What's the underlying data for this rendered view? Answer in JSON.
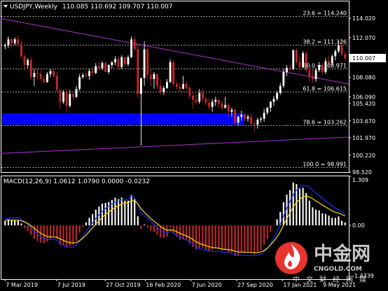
{
  "header": {
    "symbol": "USDJPY,Weekly",
    "ohlc": "110.085 110.692 109.707 110.007",
    "macd_label": "MACD(12,26,9) 1.0612 1.0790 0.0000 -0.0232"
  },
  "colors": {
    "background": "#000000",
    "grid": "#ffffff",
    "bull": "#ffffff",
    "bear": "#c8262a",
    "trendline": "#9b2fb8",
    "support_zone": "#0000ff",
    "macd_hist_up": "#ffffff",
    "macd_hist_down": "#c8262a",
    "macd_signal": "#ffd700",
    "macd_main": "#1034ff",
    "current_price_tag": "#ffffff"
  },
  "watermark": {
    "brand_cn": "中金网",
    "brand_en": "CNGOLD.COM",
    "slogan": "中文财经网媒",
    "icon": "flame-logo-icon"
  },
  "chart_data": [
    {
      "type": "candlestick",
      "title": "USDJPY,Weekly",
      "ylim": [
        98.52,
        115.72
      ],
      "y_ticks": [
        "114.020",
        "112.070",
        "110.007",
        "108.080",
        "106.090",
        "105.420",
        "103.670",
        "101.970",
        "100.220",
        "98.520"
      ],
      "current_price": "110.007",
      "x_ticks": [
        "7 Mar 2019",
        "7 Jul 2019",
        "27 Oct 2019",
        "16 Feb 2020",
        "7 Jun 2020",
        "27 Sep 2020",
        "17 Jan 2021",
        "9 May 2021"
      ],
      "fib_levels": [
        {
          "label": "23.6 = 114.240",
          "value": 114.24
        },
        {
          "label": "38.2 = 111.326",
          "value": 111.326
        },
        {
          "label": "50.0 = 108.971",
          "value": 108.971
        },
        {
          "label": "61.8 = 106.615",
          "value": 106.615
        },
        {
          "label": "78.6 = 103.262",
          "value": 103.262
        },
        {
          "label": "100.0 = 98.991",
          "value": 98.991
        }
      ],
      "support_zone": {
        "low": 103.3,
        "high": 104.45
      },
      "trendlines": [
        {
          "name": "upper",
          "from": [
            0,
            114.0
          ],
          "to": [
            129,
            107.4
          ]
        },
        {
          "name": "lower",
          "from": [
            0,
            100.4
          ],
          "to": [
            129,
            102.05
          ]
        }
      ],
      "bars": [
        [
          111.2,
          111.5,
          110.9,
          111.3
        ],
        [
          111.3,
          112.2,
          111.0,
          111.9
        ],
        [
          111.9,
          112.0,
          111.1,
          111.5
        ],
        [
          111.5,
          112.1,
          111.3,
          111.9
        ],
        [
          111.9,
          112.3,
          111.5,
          111.4
        ],
        [
          111.4,
          111.7,
          110.0,
          110.2
        ],
        [
          110.2,
          110.4,
          108.8,
          109.3
        ],
        [
          109.3,
          110.0,
          109.0,
          109.8
        ],
        [
          109.8,
          110.1,
          107.8,
          108.1
        ],
        [
          108.1,
          108.9,
          107.2,
          108.5
        ],
        [
          108.5,
          109.0,
          107.9,
          108.4
        ],
        [
          108.4,
          108.8,
          107.7,
          107.9
        ],
        [
          107.9,
          108.2,
          107.4,
          107.6
        ],
        [
          107.6,
          108.6,
          107.5,
          108.4
        ],
        [
          108.4,
          108.9,
          108.1,
          108.7
        ],
        [
          108.7,
          108.9,
          108.1,
          108.2
        ],
        [
          108.2,
          108.6,
          106.6,
          106.8
        ],
        [
          106.8,
          106.9,
          104.9,
          105.6
        ],
        [
          105.6,
          106.8,
          105.4,
          106.6
        ],
        [
          106.6,
          106.9,
          104.5,
          105.2
        ],
        [
          105.2,
          106.8,
          105.0,
          106.4
        ],
        [
          106.4,
          106.6,
          105.8,
          106.1
        ],
        [
          106.1,
          107.2,
          106.0,
          106.9
        ],
        [
          106.9,
          108.4,
          106.7,
          108.1
        ],
        [
          108.1,
          108.5,
          107.9,
          108.3
        ],
        [
          108.3,
          108.7,
          108.0,
          108.2
        ],
        [
          108.2,
          108.9,
          107.8,
          108.7
        ],
        [
          108.7,
          109.1,
          108.3,
          108.5
        ],
        [
          108.5,
          109.5,
          108.4,
          109.2
        ],
        [
          109.2,
          109.6,
          108.9,
          109.0
        ],
        [
          109.0,
          109.7,
          108.8,
          109.5
        ],
        [
          109.5,
          109.7,
          108.6,
          108.6
        ],
        [
          108.6,
          109.4,
          108.4,
          109.3
        ],
        [
          109.3,
          109.7,
          109.0,
          109.6
        ],
        [
          109.6,
          110.2,
          109.3,
          109.9
        ],
        [
          109.9,
          110.2,
          108.9,
          109.1
        ],
        [
          109.1,
          110.3,
          108.9,
          110.1
        ],
        [
          110.1,
          110.0,
          109.2,
          109.4
        ],
        [
          109.4,
          110.3,
          109.2,
          110.1
        ],
        [
          110.1,
          112.2,
          110.0,
          111.9
        ],
        [
          111.9,
          112.2,
          110.7,
          110.9
        ],
        [
          110.9,
          111.3,
          106.0,
          106.4
        ],
        [
          106.4,
          106.8,
          101.2,
          108.0
        ],
        [
          108.0,
          111.7,
          107.2,
          110.9
        ],
        [
          110.9,
          111.0,
          107.8,
          108.3
        ],
        [
          108.3,
          108.9,
          107.2,
          107.9
        ],
        [
          107.9,
          108.6,
          106.9,
          108.4
        ],
        [
          108.4,
          108.2,
          106.9,
          107.2
        ],
        [
          107.2,
          107.8,
          106.3,
          106.6
        ],
        [
          106.6,
          107.2,
          106.3,
          107.0
        ],
        [
          107.0,
          107.9,
          106.9,
          107.6
        ],
        [
          107.6,
          109.9,
          107.5,
          109.6
        ],
        [
          109.6,
          109.8,
          107.2,
          107.4
        ],
        [
          107.4,
          107.7,
          106.8,
          107.1
        ],
        [
          107.1,
          107.6,
          106.6,
          106.9
        ],
        [
          106.9,
          108.2,
          106.9,
          107.4
        ],
        [
          107.4,
          107.7,
          106.8,
          107.0
        ],
        [
          107.0,
          107.2,
          105.9,
          106.2
        ],
        [
          106.2,
          106.6,
          104.9,
          105.8
        ],
        [
          105.8,
          106.4,
          105.3,
          105.6
        ],
        [
          105.6,
          106.9,
          105.4,
          106.5
        ],
        [
          106.5,
          106.9,
          105.6,
          105.9
        ],
        [
          105.9,
          106.1,
          105.2,
          105.5
        ],
        [
          105.5,
          105.9,
          104.8,
          105.1
        ],
        [
          105.1,
          105.9,
          104.6,
          105.6
        ],
        [
          105.6,
          106.1,
          105.2,
          105.8
        ],
        [
          105.8,
          105.9,
          105.0,
          105.4
        ],
        [
          105.4,
          105.7,
          104.7,
          105.0
        ],
        [
          105.0,
          106.1,
          104.9,
          105.3
        ],
        [
          105.3,
          105.5,
          104.0,
          104.6
        ],
        [
          104.6,
          105.0,
          104.1,
          104.8
        ],
        [
          104.8,
          104.9,
          103.2,
          103.5
        ],
        [
          103.5,
          104.2,
          103.2,
          104.1
        ],
        [
          104.1,
          104.7,
          103.7,
          104.3
        ],
        [
          104.3,
          104.5,
          103.6,
          103.9
        ],
        [
          103.9,
          104.3,
          103.6,
          104.1
        ],
        [
          104.1,
          104.4,
          103.3,
          103.4
        ],
        [
          103.4,
          103.7,
          102.6,
          103.3
        ],
        [
          103.3,
          104.0,
          102.9,
          103.8
        ],
        [
          103.8,
          104.1,
          103.5,
          103.9
        ],
        [
          103.9,
          104.9,
          103.6,
          104.5
        ],
        [
          104.5,
          105.1,
          104.3,
          105.0
        ],
        [
          105.0,
          105.7,
          104.6,
          105.6
        ],
        [
          105.6,
          106.2,
          105.2,
          105.9
        ],
        [
          105.9,
          106.7,
          105.7,
          106.5
        ],
        [
          106.5,
          107.5,
          106.3,
          107.2
        ],
        [
          107.2,
          108.9,
          107.0,
          108.6
        ],
        [
          108.6,
          109.3,
          108.2,
          109.0
        ],
        [
          109.0,
          109.4,
          108.6,
          108.9
        ],
        [
          108.9,
          110.9,
          108.8,
          110.8
        ],
        [
          110.8,
          111.0,
          109.3,
          109.6
        ],
        [
          109.6,
          110.2,
          108.8,
          109.1
        ],
        [
          109.1,
          110.7,
          109.0,
          110.5
        ],
        [
          110.5,
          110.7,
          108.6,
          108.8
        ],
        [
          108.8,
          109.0,
          107.6,
          108.2
        ],
        [
          108.2,
          108.9,
          107.5,
          107.9
        ],
        [
          107.9,
          109.0,
          107.6,
          108.8
        ],
        [
          108.8,
          109.6,
          108.6,
          109.3
        ],
        [
          109.3,
          109.5,
          108.3,
          108.6
        ],
        [
          108.6,
          110.0,
          108.4,
          109.7
        ],
        [
          109.7,
          110.3,
          109.2,
          109.5
        ],
        [
          109.5,
          110.4,
          109.3,
          110.2
        ],
        [
          110.2,
          110.9,
          109.8,
          110.7
        ],
        [
          110.7,
          111.7,
          110.5,
          111.3
        ],
        [
          111.3,
          112.0,
          110.2,
          110.4
        ],
        [
          110.4,
          110.7,
          109.7,
          110.0
        ]
      ]
    },
    {
      "type": "bar",
      "title": "MACD(12,26,9)",
      "ylim": [
        -1.4339,
        1.309
      ],
      "y_ticks": [
        "1.309",
        "0.00",
        "-1.4339"
      ],
      "histogram": [
        0.12,
        0.16,
        0.14,
        0.15,
        0.13,
        0.05,
        -0.08,
        -0.15,
        -0.26,
        -0.36,
        -0.42,
        -0.46,
        -0.48,
        -0.44,
        -0.37,
        -0.3,
        -0.36,
        -0.52,
        -0.52,
        -0.58,
        -0.55,
        -0.52,
        -0.42,
        -0.2,
        -0.05,
        0.08,
        0.2,
        0.3,
        0.42,
        0.5,
        0.58,
        0.6,
        0.62,
        0.68,
        0.74,
        0.7,
        0.74,
        0.66,
        0.66,
        0.8,
        0.7,
        0.24,
        -0.1,
        0.02,
        -0.06,
        -0.14,
        -0.18,
        -0.25,
        -0.32,
        -0.34,
        -0.3,
        -0.06,
        -0.2,
        -0.3,
        -0.38,
        -0.38,
        -0.4,
        -0.48,
        -0.58,
        -0.64,
        -0.6,
        -0.6,
        -0.64,
        -0.68,
        -0.66,
        -0.62,
        -0.64,
        -0.68,
        -0.66,
        -0.72,
        -0.72,
        -0.82,
        -0.8,
        -0.74,
        -0.74,
        -0.7,
        -0.74,
        -0.78,
        -0.72,
        -0.66,
        -0.52,
        -0.36,
        -0.18,
        -0.02,
        0.16,
        0.36,
        0.62,
        0.82,
        0.94,
        1.14,
        1.1,
        0.98,
        1.0,
        0.86,
        0.66,
        0.48,
        0.42,
        0.4,
        0.32,
        0.3,
        0.26,
        0.2,
        0.2,
        0.24,
        0.12,
        0.08
      ],
      "signal": [
        0.14,
        0.14,
        0.14,
        0.14,
        0.14,
        0.12,
        0.09,
        0.05,
        -0.01,
        -0.08,
        -0.15,
        -0.21,
        -0.26,
        -0.3,
        -0.31,
        -0.31,
        -0.32,
        -0.36,
        -0.4,
        -0.44,
        -0.46,
        -0.47,
        -0.46,
        -0.41,
        -0.34,
        -0.26,
        -0.16,
        -0.07,
        0.03,
        0.12,
        0.21,
        0.29,
        0.35,
        0.42,
        0.48,
        0.52,
        0.57,
        0.59,
        0.61,
        0.65,
        0.66,
        0.58,
        0.44,
        0.35,
        0.27,
        0.18,
        0.11,
        0.04,
        -0.03,
        -0.09,
        -0.13,
        -0.12,
        -0.13,
        -0.17,
        -0.21,
        -0.25,
        -0.28,
        -0.33,
        -0.38,
        -0.44,
        -0.48,
        -0.51,
        -0.54,
        -0.57,
        -0.59,
        -0.6,
        -0.61,
        -0.63,
        -0.64,
        -0.65,
        -0.66,
        -0.69,
        -0.71,
        -0.71,
        -0.72,
        -0.72,
        -0.72,
        -0.73,
        -0.73,
        -0.71,
        -0.67,
        -0.61,
        -0.52,
        -0.42,
        -0.31,
        -0.17,
        0.01,
        0.18,
        0.33,
        0.49,
        0.61,
        0.69,
        0.76,
        0.78,
        0.76,
        0.71,
        0.65,
        0.6,
        0.54,
        0.49,
        0.44,
        0.39,
        0.35,
        0.33,
        0.29,
        0.25
      ],
      "main": [
        0.18,
        0.19,
        0.2,
        0.21,
        0.2,
        0.16,
        0.11,
        0.03,
        -0.06,
        -0.15,
        -0.23,
        -0.3,
        -0.35,
        -0.38,
        -0.37,
        -0.36,
        -0.4,
        -0.48,
        -0.53,
        -0.58,
        -0.59,
        -0.58,
        -0.52,
        -0.42,
        -0.29,
        -0.17,
        -0.05,
        0.07,
        0.18,
        0.28,
        0.37,
        0.45,
        0.51,
        0.57,
        0.62,
        0.64,
        0.68,
        0.69,
        0.7,
        0.76,
        0.74,
        0.56,
        0.32,
        0.28,
        0.2,
        0.11,
        0.03,
        -0.06,
        -0.14,
        -0.2,
        -0.22,
        -0.14,
        -0.21,
        -0.26,
        -0.31,
        -0.35,
        -0.39,
        -0.44,
        -0.5,
        -0.57,
        -0.62,
        -0.64,
        -0.66,
        -0.69,
        -0.7,
        -0.7,
        -0.7,
        -0.72,
        -0.72,
        -0.74,
        -0.75,
        -0.79,
        -0.8,
        -0.8,
        -0.8,
        -0.8,
        -0.8,
        -0.81,
        -0.8,
        -0.77,
        -0.71,
        -0.62,
        -0.49,
        -0.34,
        -0.17,
        0.03,
        0.25,
        0.46,
        0.64,
        0.82,
        0.94,
        1.0,
        1.06,
        1.06,
        1.01,
        0.93,
        0.86,
        0.79,
        0.72,
        0.65,
        0.59,
        0.52,
        0.46,
        0.43,
        0.36,
        0.3
      ]
    }
  ]
}
